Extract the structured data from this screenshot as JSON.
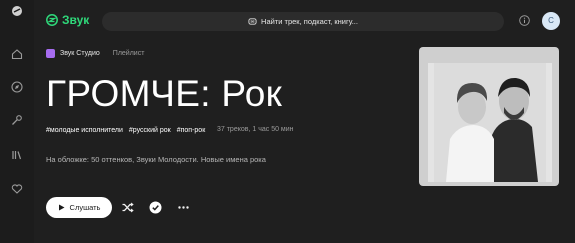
{
  "app": {
    "logo_text": "Звук"
  },
  "search": {
    "placeholder": "Найти трек, подкаст, книгу..."
  },
  "user": {
    "avatar_letter": "C"
  },
  "sidebar": {
    "icons": [
      "app-logo-icon",
      "home-icon",
      "compass-icon",
      "mic-icon",
      "library-icon",
      "heart-icon"
    ]
  },
  "playlist": {
    "studio": "Звук Студио",
    "type": "Плейлист",
    "title": "ГРОМЧЕ: Рок",
    "tags": [
      "#молодые исполнители",
      "#русский рок",
      "#поп-рок"
    ],
    "meta": "37 треков, 1 час 50 мин",
    "description": "На обложке: 50 оттенков, Звуки Молодости. Новые имена рока"
  },
  "actions": {
    "play_label": "Слушать"
  },
  "colors": {
    "brand": "#2fd87a",
    "studio_badge": "#a66cf0",
    "background": "#1f1f1f"
  }
}
